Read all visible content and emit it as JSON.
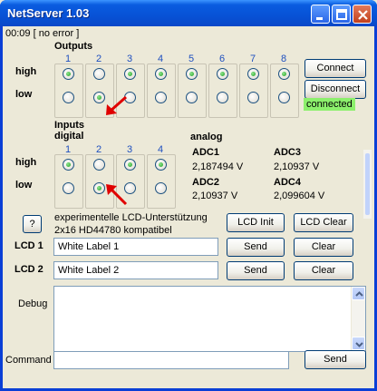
{
  "window": {
    "title": "NetServer 1.03"
  },
  "status_line": "00:09 [ no error ]",
  "outputs": {
    "heading": "Outputs",
    "row_high": "high",
    "row_low": "low",
    "columns": [
      "1",
      "2",
      "3",
      "4",
      "5",
      "6",
      "7",
      "8"
    ],
    "selected_low": [
      2
    ]
  },
  "buttons": {
    "connect": "Connect",
    "disconnect": "Disconnect",
    "connection_status": "connected",
    "help": "?",
    "lcd_init": "LCD Init",
    "lcd_clear": "LCD Clear",
    "send1": "Send",
    "clear1": "Clear",
    "send2": "Send",
    "clear2": "Clear",
    "send_cmd": "Send"
  },
  "inputs": {
    "heading_line1": "Inputs",
    "heading_line2": "digital",
    "row_high": "high",
    "row_low": "low",
    "columns": [
      "1",
      "2",
      "3",
      "4"
    ],
    "selected_low": [
      2
    ]
  },
  "analog": {
    "heading": "analog",
    "adc": [
      {
        "label": "ADC1",
        "value": "2,187494 V"
      },
      {
        "label": "ADC3",
        "value": "2,10937 V"
      },
      {
        "label": "ADC2",
        "value": "2,10937 V"
      },
      {
        "label": "ADC4",
        "value": "2,099604 V"
      }
    ]
  },
  "lcd": {
    "info_line1": "experimentelle LCD-Unterstützung",
    "info_line2": "2x16 HD44780 kompatibel",
    "lcd1_label": "LCD 1",
    "lcd1_value": "White Label 1",
    "lcd2_label": "LCD 2",
    "lcd2_value": "White Label 2"
  },
  "debug": {
    "label": "Debug",
    "value": ""
  },
  "command": {
    "label": "Command",
    "value": ""
  },
  "colors": {
    "connected_bg": "#8cf06c",
    "column_number": "#1e4fbf",
    "arrow": "#e00000"
  }
}
